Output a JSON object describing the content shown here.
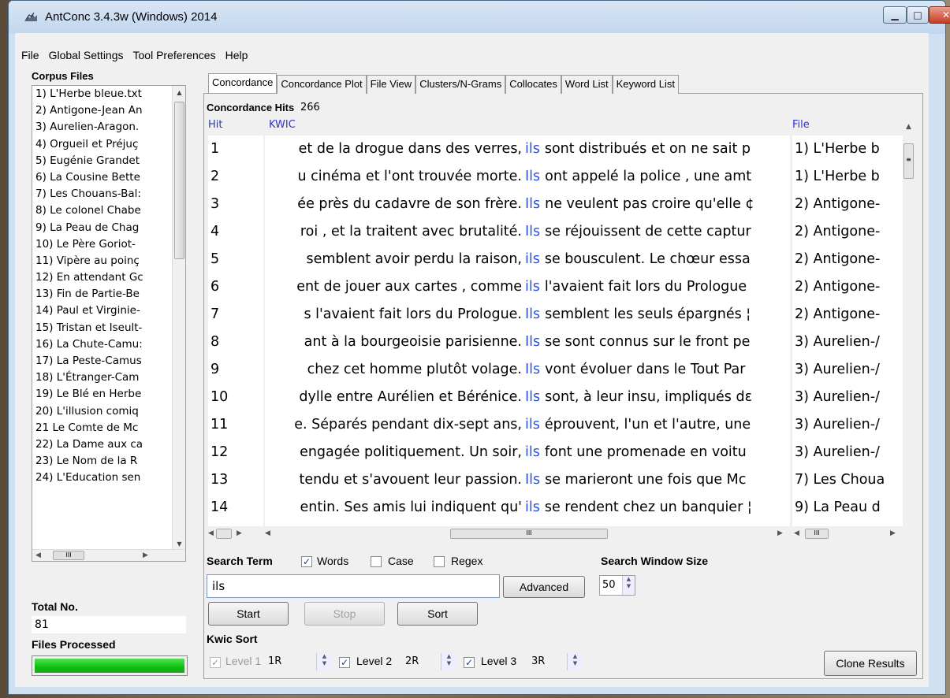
{
  "window": {
    "title": "AntConc 3.4.3w (Windows) 2014",
    "min_glyph": "▁",
    "max_glyph": "□",
    "close_glyph": "✕"
  },
  "menu": [
    "File",
    "Global Settings",
    "Tool Preferences",
    "Help"
  ],
  "corpus": {
    "title": "Corpus Files",
    "files": [
      "1) L'Herbe bleue.txt",
      "2) Antigone-Jean An",
      "3) Aurelien-Aragon.",
      "4) Orgueil et Préjuç",
      "5) Eugénie Grandet",
      "6) La Cousine Bette",
      "7) Les Chouans-Bal:",
      "8) Le colonel Chabe",
      "9) La Peau de Chag",
      "10) Le Père Goriot-",
      "11) Vipère au poinç",
      "12) En attendant Gc",
      "13) Fin de Partie-Be",
      "14) Paul et Virginie-",
      "15) Tristan et Iseult-",
      "16) La Chute-Camu:",
      "17) La Peste-Camus",
      "18) L'Étranger-Cam",
      "19) Le Blé en Herbe",
      "20) L'illusion comiq",
      "21 Le Comte de Mc",
      "22) La Dame aux ca",
      "23) Le Nom de la R",
      "24) L'Education sen"
    ],
    "total_label": "Total No.",
    "total_value": "81",
    "files_processed_label": "Files Processed",
    "progress": 1.0
  },
  "tabs": [
    "Concordance",
    "Concordance Plot",
    "File View",
    "Clusters/N-Grams",
    "Collocates",
    "Word List",
    "Keyword List"
  ],
  "active_tab": "Concordance",
  "concordance": {
    "hits_label": "Concordance Hits",
    "hits_count": "266",
    "col_hit": "Hit",
    "col_kwic": "KWIC",
    "col_file": "File",
    "rows": [
      {
        "hit": "1",
        "left": "et de la drogue dans des verres,",
        "kw": "ils",
        "right": "sont distribués et on ne sait p",
        "file": "1) L'Herbe b"
      },
      {
        "hit": "2",
        "left": "u cinéma et l'ont trouvée morte.",
        "kw": "Ils",
        "right": "ont appelé la police , une amt",
        "file": "1) L'Herbe b"
      },
      {
        "hit": "3",
        "left": "ée près du cadavre de son frère.",
        "kw": "Ils",
        "right": "ne veulent pas croire qu'elle ¢",
        "file": "2) Antigone-"
      },
      {
        "hit": "4",
        "left": "roi , et la traitent avec brutalité.",
        "kw": "Ils",
        "right": "se réjouissent de cette captur",
        "file": "2) Antigone-"
      },
      {
        "hit": "5",
        "left": "semblent avoir perdu la raison,",
        "kw": "ils",
        "right": "se bousculent. Le chœur essa",
        "file": "2) Antigone-"
      },
      {
        "hit": "6",
        "left": "ent de jouer aux cartes , comme",
        "kw": "ils",
        "right": "l'avaient fait lors du Prologue",
        "file": "2) Antigone-"
      },
      {
        "hit": "7",
        "left": "s l'avaient fait lors du Prologue.",
        "kw": "Ils",
        "right": "semblent les seuls épargnés ¦",
        "file": "2) Antigone-"
      },
      {
        "hit": "8",
        "left": "ant à la bourgeoisie parisienne.",
        "kw": "Ils",
        "right": "se sont connus sur le front pe",
        "file": "3) Aurelien-/"
      },
      {
        "hit": "9",
        "left": "chez cet homme plutôt volage.",
        "kw": "Ils",
        "right": "vont évoluer dans le Tout Par",
        "file": "3) Aurelien-/"
      },
      {
        "hit": "10",
        "left": "dylle entre Aurélien et Bérénice.",
        "kw": "Ils",
        "right": "sont, à leur insu, impliqués dε",
        "file": "3) Aurelien-/"
      },
      {
        "hit": "11",
        "left": "e. Séparés pendant dix-sept ans,",
        "kw": "ils",
        "right": "éprouvent, l'un et l'autre, une",
        "file": "3) Aurelien-/"
      },
      {
        "hit": "12",
        "left": "engagée politiquement. Un soir,",
        "kw": "ils",
        "right": "font une promenade en voitu",
        "file": "3) Aurelien-/"
      },
      {
        "hit": "13",
        "left": "tendu et s'avouent leur passion.",
        "kw": "Ils",
        "right": "se marieront une fois que Mc",
        "file": "7) Les Choua"
      },
      {
        "hit": "14",
        "left": "entin. Ses amis lui indiquent qu'",
        "kw": "ils",
        "right": "se rendent chez un banquier ¦",
        "file": "9) La Peau d"
      }
    ],
    "scroll_glyph": "III"
  },
  "search": {
    "term_label": "Search Term",
    "words_label": "Words",
    "words_checked": true,
    "case_label": "Case",
    "case_checked": false,
    "regex_label": "Regex",
    "regex_checked": false,
    "value": "ils",
    "advanced_label": "Advanced",
    "window_size_label": "Search Window Size",
    "window_size": "50",
    "start_label": "Start",
    "stop_label": "Stop",
    "sort_label": "Sort"
  },
  "kwic_sort": {
    "label": "Kwic Sort",
    "level1_label": "Level 1",
    "level1_value": "1R",
    "level2_label": "Level 2",
    "level2_value": "2R",
    "level3_label": "Level 3",
    "level3_value": "3R",
    "clone_label": "Clone Results"
  }
}
